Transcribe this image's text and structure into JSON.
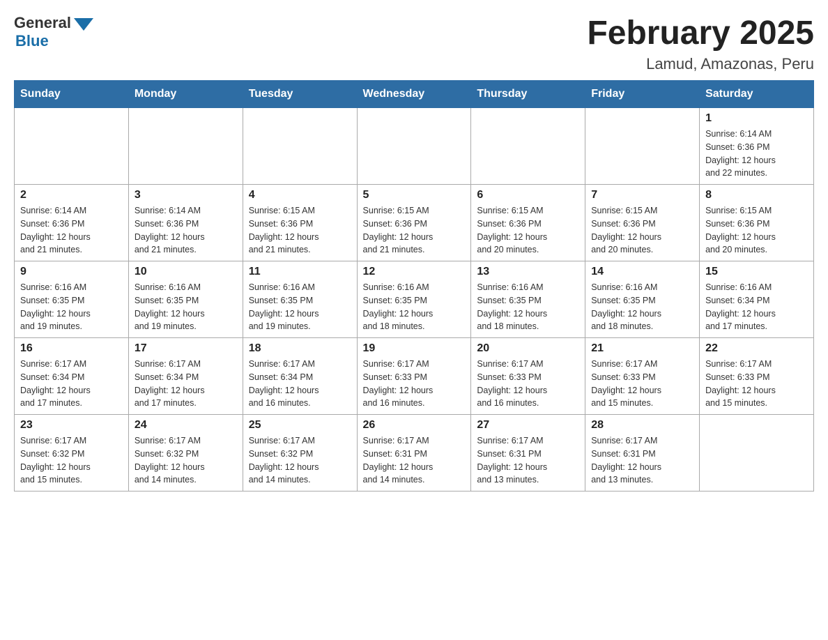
{
  "header": {
    "logo_general": "General",
    "logo_blue": "Blue",
    "month_title": "February 2025",
    "location": "Lamud, Amazonas, Peru"
  },
  "days_of_week": [
    "Sunday",
    "Monday",
    "Tuesday",
    "Wednesday",
    "Thursday",
    "Friday",
    "Saturday"
  ],
  "weeks": [
    [
      {
        "day": "",
        "info": ""
      },
      {
        "day": "",
        "info": ""
      },
      {
        "day": "",
        "info": ""
      },
      {
        "day": "",
        "info": ""
      },
      {
        "day": "",
        "info": ""
      },
      {
        "day": "",
        "info": ""
      },
      {
        "day": "1",
        "info": "Sunrise: 6:14 AM\nSunset: 6:36 PM\nDaylight: 12 hours\nand 22 minutes."
      }
    ],
    [
      {
        "day": "2",
        "info": "Sunrise: 6:14 AM\nSunset: 6:36 PM\nDaylight: 12 hours\nand 21 minutes."
      },
      {
        "day": "3",
        "info": "Sunrise: 6:14 AM\nSunset: 6:36 PM\nDaylight: 12 hours\nand 21 minutes."
      },
      {
        "day": "4",
        "info": "Sunrise: 6:15 AM\nSunset: 6:36 PM\nDaylight: 12 hours\nand 21 minutes."
      },
      {
        "day": "5",
        "info": "Sunrise: 6:15 AM\nSunset: 6:36 PM\nDaylight: 12 hours\nand 21 minutes."
      },
      {
        "day": "6",
        "info": "Sunrise: 6:15 AM\nSunset: 6:36 PM\nDaylight: 12 hours\nand 20 minutes."
      },
      {
        "day": "7",
        "info": "Sunrise: 6:15 AM\nSunset: 6:36 PM\nDaylight: 12 hours\nand 20 minutes."
      },
      {
        "day": "8",
        "info": "Sunrise: 6:15 AM\nSunset: 6:36 PM\nDaylight: 12 hours\nand 20 minutes."
      }
    ],
    [
      {
        "day": "9",
        "info": "Sunrise: 6:16 AM\nSunset: 6:35 PM\nDaylight: 12 hours\nand 19 minutes."
      },
      {
        "day": "10",
        "info": "Sunrise: 6:16 AM\nSunset: 6:35 PM\nDaylight: 12 hours\nand 19 minutes."
      },
      {
        "day": "11",
        "info": "Sunrise: 6:16 AM\nSunset: 6:35 PM\nDaylight: 12 hours\nand 19 minutes."
      },
      {
        "day": "12",
        "info": "Sunrise: 6:16 AM\nSunset: 6:35 PM\nDaylight: 12 hours\nand 18 minutes."
      },
      {
        "day": "13",
        "info": "Sunrise: 6:16 AM\nSunset: 6:35 PM\nDaylight: 12 hours\nand 18 minutes."
      },
      {
        "day": "14",
        "info": "Sunrise: 6:16 AM\nSunset: 6:35 PM\nDaylight: 12 hours\nand 18 minutes."
      },
      {
        "day": "15",
        "info": "Sunrise: 6:16 AM\nSunset: 6:34 PM\nDaylight: 12 hours\nand 17 minutes."
      }
    ],
    [
      {
        "day": "16",
        "info": "Sunrise: 6:17 AM\nSunset: 6:34 PM\nDaylight: 12 hours\nand 17 minutes."
      },
      {
        "day": "17",
        "info": "Sunrise: 6:17 AM\nSunset: 6:34 PM\nDaylight: 12 hours\nand 17 minutes."
      },
      {
        "day": "18",
        "info": "Sunrise: 6:17 AM\nSunset: 6:34 PM\nDaylight: 12 hours\nand 16 minutes."
      },
      {
        "day": "19",
        "info": "Sunrise: 6:17 AM\nSunset: 6:33 PM\nDaylight: 12 hours\nand 16 minutes."
      },
      {
        "day": "20",
        "info": "Sunrise: 6:17 AM\nSunset: 6:33 PM\nDaylight: 12 hours\nand 16 minutes."
      },
      {
        "day": "21",
        "info": "Sunrise: 6:17 AM\nSunset: 6:33 PM\nDaylight: 12 hours\nand 15 minutes."
      },
      {
        "day": "22",
        "info": "Sunrise: 6:17 AM\nSunset: 6:33 PM\nDaylight: 12 hours\nand 15 minutes."
      }
    ],
    [
      {
        "day": "23",
        "info": "Sunrise: 6:17 AM\nSunset: 6:32 PM\nDaylight: 12 hours\nand 15 minutes."
      },
      {
        "day": "24",
        "info": "Sunrise: 6:17 AM\nSunset: 6:32 PM\nDaylight: 12 hours\nand 14 minutes."
      },
      {
        "day": "25",
        "info": "Sunrise: 6:17 AM\nSunset: 6:32 PM\nDaylight: 12 hours\nand 14 minutes."
      },
      {
        "day": "26",
        "info": "Sunrise: 6:17 AM\nSunset: 6:31 PM\nDaylight: 12 hours\nand 14 minutes."
      },
      {
        "day": "27",
        "info": "Sunrise: 6:17 AM\nSunset: 6:31 PM\nDaylight: 12 hours\nand 13 minutes."
      },
      {
        "day": "28",
        "info": "Sunrise: 6:17 AM\nSunset: 6:31 PM\nDaylight: 12 hours\nand 13 minutes."
      },
      {
        "day": "",
        "info": ""
      }
    ]
  ]
}
